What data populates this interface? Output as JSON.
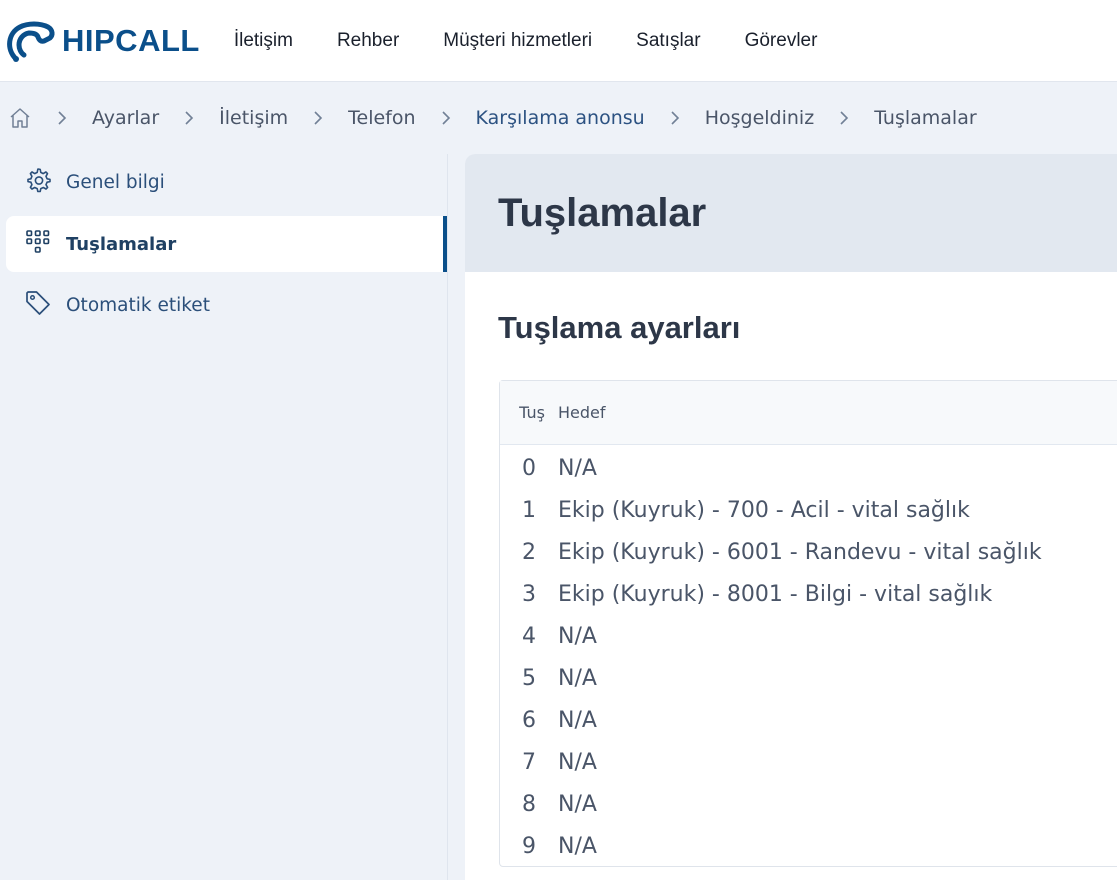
{
  "app": {
    "brand": "HIPCALL",
    "colors": {
      "brand": "#0b4f8a",
      "accent": "#2c5282",
      "background": "#eef2f8"
    }
  },
  "topnav": {
    "items": [
      {
        "label": "İletişim"
      },
      {
        "label": "Rehber"
      },
      {
        "label": "Müşteri hizmetleri"
      },
      {
        "label": "Satışlar"
      },
      {
        "label": "Görevler"
      }
    ]
  },
  "breadcrumb": {
    "home_icon": "home-icon",
    "items": [
      {
        "label": "Ayarlar"
      },
      {
        "label": "İletişim"
      },
      {
        "label": "Telefon"
      },
      {
        "label": "Karşılama anonsu"
      },
      {
        "label": "Hoşgeldiniz"
      },
      {
        "label": "Tuşlamalar"
      }
    ]
  },
  "sidebar": {
    "items": [
      {
        "label": "Genel bilgi",
        "icon": "gear-icon"
      },
      {
        "label": "Tuşlamalar",
        "icon": "keypad-icon",
        "active": true
      },
      {
        "label": "Otomatik etiket",
        "icon": "tag-icon"
      }
    ]
  },
  "main": {
    "title": "Tuşlamalar",
    "section_title": "Tuşlama ayarları",
    "table": {
      "columns": [
        "Tuş",
        "Hedef"
      ],
      "rows": [
        {
          "key": "0",
          "target": "N/A"
        },
        {
          "key": "1",
          "target": "Ekip (Kuyruk) - 700 - Acil - vital sağlık"
        },
        {
          "key": "2",
          "target": "Ekip (Kuyruk) - 6001 - Randevu - vital sağlık"
        },
        {
          "key": "3",
          "target": "Ekip (Kuyruk) - 8001 - Bilgi - vital sağlık"
        },
        {
          "key": "4",
          "target": "N/A"
        },
        {
          "key": "5",
          "target": "N/A"
        },
        {
          "key": "6",
          "target": "N/A"
        },
        {
          "key": "7",
          "target": "N/A"
        },
        {
          "key": "8",
          "target": "N/A"
        },
        {
          "key": "9",
          "target": "N/A"
        }
      ]
    }
  }
}
